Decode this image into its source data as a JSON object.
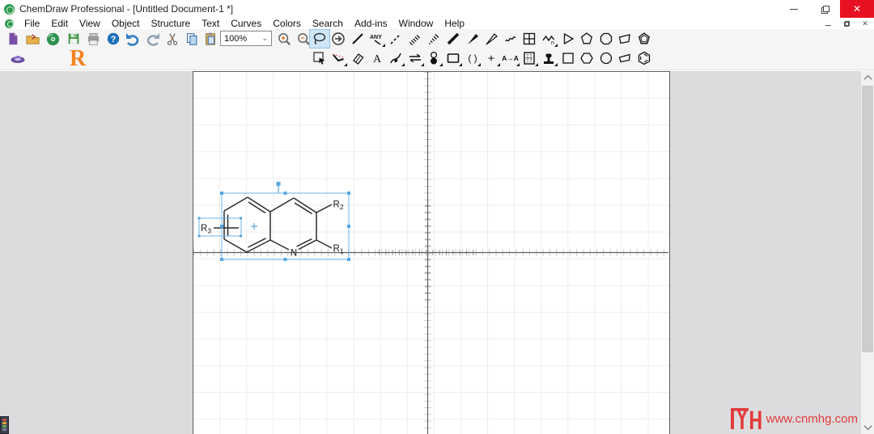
{
  "window": {
    "title": "ChemDraw Professional - [Untitled Document-1 *]",
    "controls": [
      "minimize",
      "restore",
      "close"
    ]
  },
  "menubar": {
    "items": [
      "File",
      "Edit",
      "View",
      "Object",
      "Structure",
      "Text",
      "Curves",
      "Colors",
      "Search",
      "Add-ins",
      "Window",
      "Help"
    ]
  },
  "toolbar": {
    "zoom_value": "100%",
    "rgroup_label": "R",
    "file_icons": [
      "new-document",
      "open-document",
      "save-to-cd",
      "save",
      "print",
      "help",
      "undo",
      "redo",
      "cut",
      "copy",
      "paste",
      "zoom-in",
      "zoom-out"
    ],
    "bond_tools": [
      "lasso",
      "marquee-oval",
      "solid-bond",
      "any-bond",
      "dashed-bond",
      "hashed-bond",
      "hashed-wedge-bond",
      "bold-bond",
      "wedge-bond",
      "hollow-wedge-bond",
      "wavy-bond",
      "table",
      "polymer-bead",
      "triangle-ring",
      "pentagon-ring",
      "octagon-ring",
      "flexible-ring",
      "pentagon-3d-ring"
    ],
    "draw_tools": [
      "marquee-rect",
      "bend-tool",
      "eraser",
      "text",
      "pen",
      "reaction-arrow",
      "orbital",
      "drawing-box",
      "bracket",
      "plus",
      "atom-map",
      "table-grid",
      "template-stamp",
      "square-template",
      "hexagon-template",
      "circle-template",
      "quad-template",
      "benzene-template"
    ],
    "selected_tool": "lasso",
    "icon_texts": {
      "any": "ANY",
      "text_tool": "A",
      "bracket": "( )",
      "plus": "+",
      "atom_map": "A→A",
      "polymer_n": "n"
    }
  },
  "canvas": {
    "structure": "quinoline scaffold with R-group substituents, selected",
    "labels": {
      "n": "N",
      "r1": {
        "base": "R",
        "sub": "1"
      },
      "r2": {
        "base": "R",
        "sub": "2"
      },
      "r3": {
        "base": "R",
        "sub": "3"
      }
    },
    "crosshair": "centered ruler cross with tick marks"
  },
  "scrollbar": {
    "orientation": "vertical",
    "arrows": [
      "up",
      "down"
    ]
  },
  "watermark": {
    "logo_text": "YH",
    "url": "www.cnmhg.com"
  },
  "colors": {
    "selection_blue": "#58a6e2",
    "close_button_red": "#e81123",
    "watermark_red": "#e23a3a",
    "rgroup_orange": "#f5821f",
    "canvas_grid": "#ededee",
    "workspace_gray": "#dcdcde"
  }
}
